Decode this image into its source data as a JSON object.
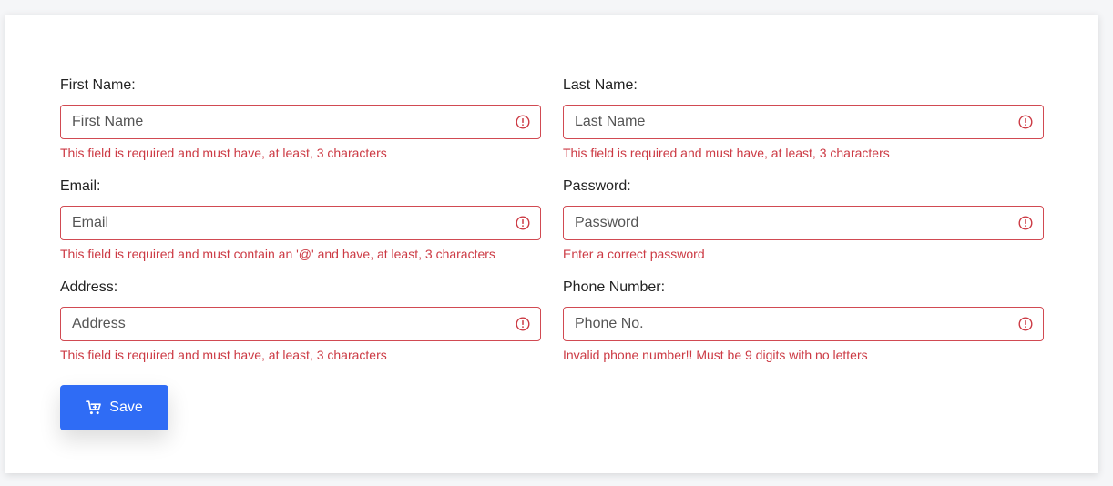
{
  "form": {
    "fields": [
      {
        "label": "First Name:",
        "placeholder": "First Name",
        "error": "This field is required and must have, at least, 3 characters"
      },
      {
        "label": "Last Name:",
        "placeholder": "Last Name",
        "error": "This field is required and must have, at least, 3 characters"
      },
      {
        "label": "Email:",
        "placeholder": "Email",
        "error": "This field is required and must contain an '@' and have, at least, 3 characters"
      },
      {
        "label": "Password:",
        "placeholder": "Password",
        "error": "Enter a correct password"
      },
      {
        "label": "Address:",
        "placeholder": "Address",
        "error": "This field is required and must have, at least, 3 characters"
      },
      {
        "label": "Phone Number:",
        "placeholder": "Phone No.",
        "error": "Invalid phone number!! Must be 9 digits with no letters"
      }
    ],
    "save_label": "Save",
    "save_icon": "cart-plus-icon",
    "error_icon": "exclamation-circle-icon"
  },
  "colors": {
    "error": "#cc3a44",
    "input_border_error": "#d14a52",
    "primary": "#2f6cf5",
    "card_bg": "#ffffff"
  }
}
